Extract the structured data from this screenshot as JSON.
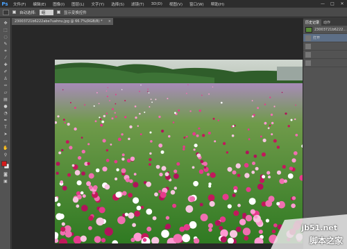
{
  "app": {
    "logo": "Ps"
  },
  "menu": [
    "文件(F)",
    "编辑(E)",
    "图像(I)",
    "图层(L)",
    "文字(Y)",
    "选择(S)",
    "滤镜(T)",
    "3D(D)",
    "视图(V)",
    "窗口(W)",
    "帮助(H)"
  ],
  "options": {
    "auto_select_label": "自动选择:",
    "auto_select_value": "组",
    "transform_label": "显示变换控件"
  },
  "document": {
    "tab_title": "23003721b6222abe7uahnu.jpg @ 66.7%(RGB/8) *"
  },
  "panels": {
    "tabs": [
      "历史记录",
      "动作"
    ],
    "history": [
      {
        "label": "23003721b6222..."
      },
      {
        "label": "打开"
      },
      {
        "label": ""
      },
      {
        "label": ""
      },
      {
        "label": ""
      }
    ]
  },
  "watermark": {
    "site": "jb51.net",
    "name": "脚本之家"
  },
  "colors": {
    "foreground": "#d41c1c",
    "background": "#e8e8e8"
  }
}
